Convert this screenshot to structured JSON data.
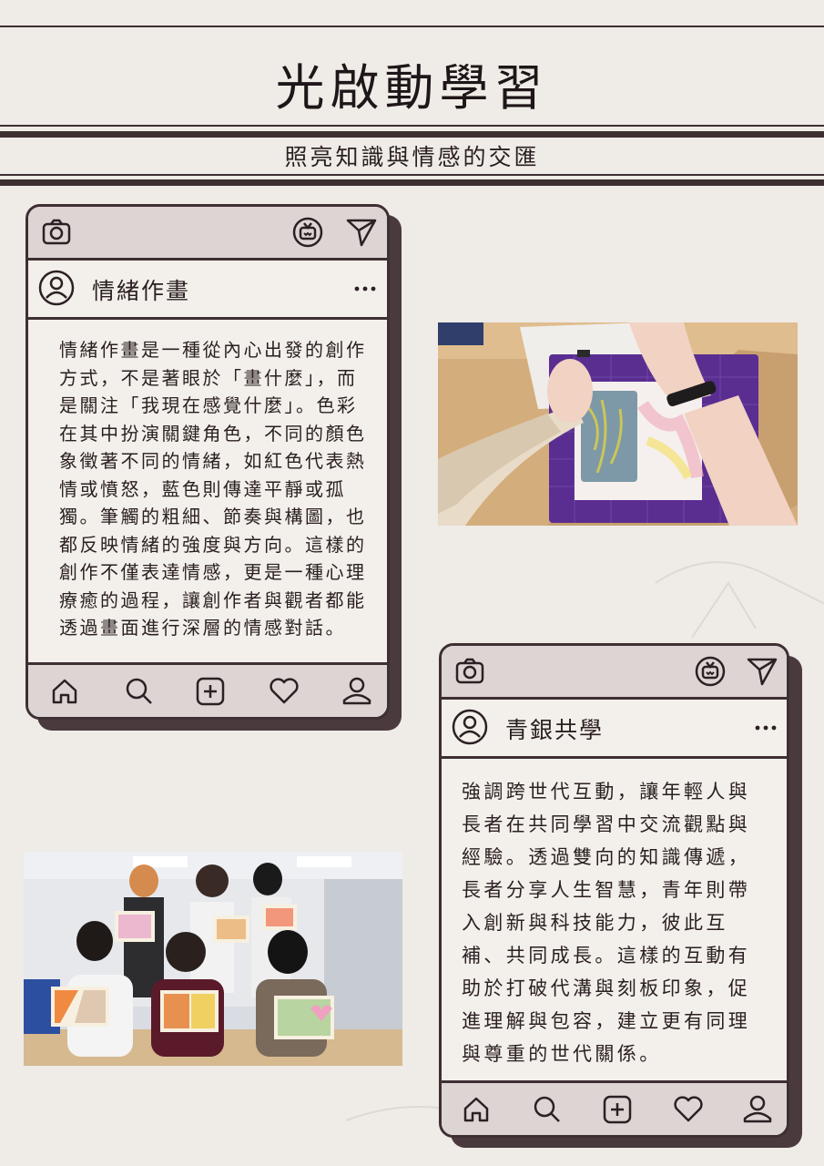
{
  "header": {
    "title": "光啟動學習",
    "subtitle": "照亮知識與情感的交匯"
  },
  "post1": {
    "username": "情緒作畫",
    "more": "…",
    "lines": [
      "情緒作畫是一種從內心出發的創作",
      "方式，不是著眼於「畫什麼」，而",
      "是關注「我現在感覺什麼」。色彩",
      "在其中扮演關鍵角色，不同的顏色",
      "象徵著不同的情緒，如紅色代表熱",
      "情或憤怒，藍色則傳達平靜或孤",
      "獨。筆觸的粗細、節奏與構圖，也",
      "都反映情緒的強度與方向。這樣的",
      "創作不僅表達情感，更是一種心理",
      "療癒的過程，讓創作者與觀者都能",
      "透過畫面進行深層的情感對話。"
    ]
  },
  "post2": {
    "username": "青銀共學",
    "more": "…",
    "lines": [
      "強調跨世代互動，讓年輕人與",
      "長者在共同學習中交流觀點與",
      "經驗。透過雙向的知識傳遞，",
      "長者分享人生智慧，青年則帶",
      "入創新與科技能力，彼此互",
      "補、共同成長。這樣的互動有",
      "助於打破代溝與刻板印象，促",
      "進理解與包容，建立更有同理",
      "與尊重的世代關係。"
    ]
  },
  "icons": {
    "top": [
      "camera-icon",
      "igtv-icon",
      "send-icon"
    ],
    "user": [
      "user-circle-icon",
      "more-icon"
    ],
    "bottom": [
      "home-icon",
      "search-icon",
      "add-icon",
      "heart-icon",
      "profile-icon"
    ]
  },
  "colors": {
    "background": "#efebe6",
    "frame": "#3e2f33",
    "bar": "#ddd5d4",
    "mat_purple": "#5a2d91"
  }
}
